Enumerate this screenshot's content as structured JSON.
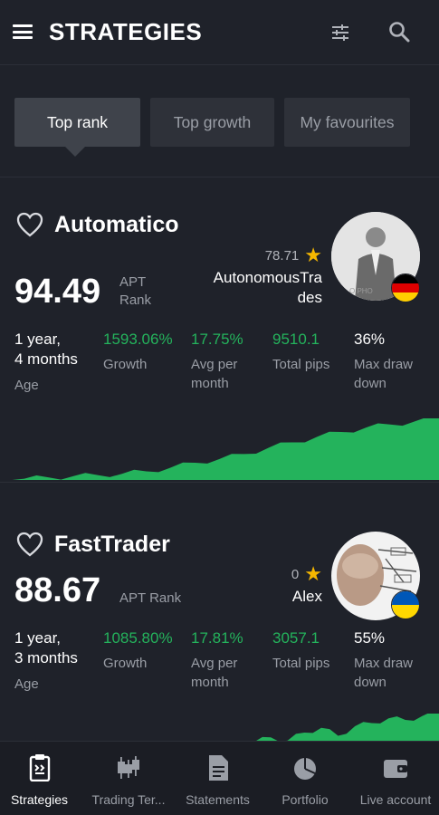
{
  "header": {
    "title": "STRATEGIES"
  },
  "tabs": [
    {
      "label": "Top rank",
      "active": true
    },
    {
      "label": "Top growth",
      "active": false
    },
    {
      "label": "My favourites",
      "active": false
    }
  ],
  "strategies": [
    {
      "name": "Automatico",
      "rank_value": "94.49",
      "rank_label_line1": "APT",
      "rank_label_line2": "Rank",
      "author_rating": "78.71",
      "author_name_line1": "AutonomousTra",
      "author_name_line2": "des",
      "author_flag": "germany",
      "age_line1": "1 year,",
      "age_line2": "4 months",
      "age_label": "Age",
      "growth": "1593.06%",
      "growth_label": "Growth",
      "avg_month": "17.75%",
      "avg_label_line1": "Avg per",
      "avg_label_line2": "month",
      "pips": "9510.1",
      "pips_label": "Total pips",
      "drawdown": "36%",
      "drawdown_label_line1": "Max draw",
      "drawdown_label_line2": "down",
      "equity_curve": [
        0.0,
        0.02,
        0.04,
        0.06,
        0.08,
        0.1,
        0.14,
        0.2,
        0.28,
        0.34,
        0.42,
        0.52,
        0.61,
        0.7,
        0.78,
        0.85,
        0.9,
        0.95,
        1.0
      ]
    },
    {
      "name": "FastTrader",
      "rank_value": "88.67",
      "rank_label": "APT Rank",
      "author_rating": "0",
      "author_name": "Alex",
      "author_flag": "ukraine",
      "age_line1": "1 year,",
      "age_line2": "3 months",
      "age_label": "Age",
      "growth": "1085.80%",
      "growth_label": "Growth",
      "avg_month": "17.81%",
      "avg_label_line1": "Avg per",
      "avg_label_line2": "month",
      "pips": "3057.1",
      "pips_label": "Total pips",
      "drawdown": "55%",
      "drawdown_label_line1": "Max draw",
      "drawdown_label_line2": "down",
      "equity_curve": [
        0.0,
        0.1,
        0.25,
        0.15,
        0.4,
        0.55,
        0.3,
        0.6,
        0.7,
        0.85,
        0.8,
        0.92,
        1.0
      ]
    }
  ],
  "bottom_nav": [
    {
      "label": "Strategies",
      "icon": "strategies-icon",
      "active": true
    },
    {
      "label": "Trading Ter...",
      "icon": "candlestick-icon",
      "active": false
    },
    {
      "label": "Statements",
      "icon": "document-icon",
      "active": false
    },
    {
      "label": "Portfolio",
      "icon": "pie-chart-icon",
      "active": false
    },
    {
      "label": "Live account",
      "icon": "wallet-icon",
      "active": false
    }
  ],
  "colors": {
    "background": "#1f222a",
    "green": "#24b35c",
    "star": "#f5b700"
  }
}
